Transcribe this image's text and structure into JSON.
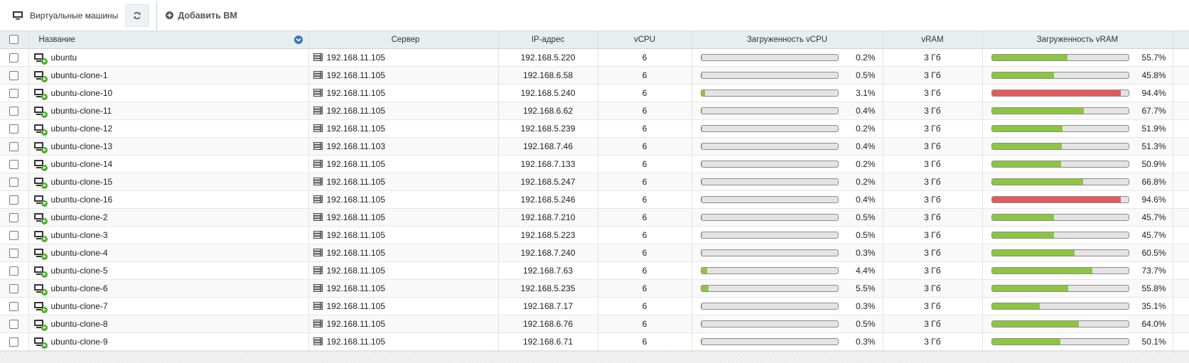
{
  "toolbar": {
    "title": "Виртуальные машины",
    "add_label": "Добавить ВМ"
  },
  "columns": {
    "name": "Название",
    "server": "Сервер",
    "ip": "IP-адрес",
    "vcpu": "vCPU",
    "cpu_load": "Загруженность vCPU",
    "vram": "vRAM",
    "ram_load": "Загруженность vRAM"
  },
  "colors": {
    "ok": "#8cc63f",
    "high": "#e05c5c",
    "running": "#4caf27"
  },
  "vms": [
    {
      "name": "ubuntu",
      "server": "192.168.11.105",
      "ip": "192.168.5.220",
      "vcpu": "6",
      "cpu": 0.2,
      "cpu_label": "0.2%",
      "vram": "3 Гб",
      "ram": 55.7,
      "ram_label": "55.7%"
    },
    {
      "name": "ubuntu-clone-1",
      "server": "192.168.11.105",
      "ip": "192.168.6.58",
      "vcpu": "6",
      "cpu": 0.5,
      "cpu_label": "0.5%",
      "vram": "3 Гб",
      "ram": 45.8,
      "ram_label": "45.8%"
    },
    {
      "name": "ubuntu-clone-10",
      "server": "192.168.11.105",
      "ip": "192.168.5.240",
      "vcpu": "6",
      "cpu": 3.1,
      "cpu_label": "3.1%",
      "vram": "3 Гб",
      "ram": 94.4,
      "ram_label": "94.4%"
    },
    {
      "name": "ubuntu-clone-11",
      "server": "192.168.11.105",
      "ip": "192.168.6.62",
      "vcpu": "6",
      "cpu": 0.4,
      "cpu_label": "0.4%",
      "vram": "3 Гб",
      "ram": 67.7,
      "ram_label": "67.7%"
    },
    {
      "name": "ubuntu-clone-12",
      "server": "192.168.11.105",
      "ip": "192.168.5.239",
      "vcpu": "6",
      "cpu": 0.2,
      "cpu_label": "0.2%",
      "vram": "3 Гб",
      "ram": 51.9,
      "ram_label": "51.9%"
    },
    {
      "name": "ubuntu-clone-13",
      "server": "192.168.11.103",
      "ip": "192.168.7.46",
      "vcpu": "6",
      "cpu": 0.4,
      "cpu_label": "0.4%",
      "vram": "3 Гб",
      "ram": 51.3,
      "ram_label": "51.3%"
    },
    {
      "name": "ubuntu-clone-14",
      "server": "192.168.11.105",
      "ip": "192.168.7.133",
      "vcpu": "6",
      "cpu": 0.2,
      "cpu_label": "0.2%",
      "vram": "3 Гб",
      "ram": 50.9,
      "ram_label": "50.9%"
    },
    {
      "name": "ubuntu-clone-15",
      "server": "192.168.11.105",
      "ip": "192.168.5.247",
      "vcpu": "6",
      "cpu": 0.2,
      "cpu_label": "0.2%",
      "vram": "3 Гб",
      "ram": 66.8,
      "ram_label": "66.8%"
    },
    {
      "name": "ubuntu-clone-16",
      "server": "192.168.11.105",
      "ip": "192.168.5.246",
      "vcpu": "6",
      "cpu": 0.4,
      "cpu_label": "0.4%",
      "vram": "3 Гб",
      "ram": 94.6,
      "ram_label": "94.6%"
    },
    {
      "name": "ubuntu-clone-2",
      "server": "192.168.11.105",
      "ip": "192.168.7.210",
      "vcpu": "6",
      "cpu": 0.5,
      "cpu_label": "0.5%",
      "vram": "3 Гб",
      "ram": 45.7,
      "ram_label": "45.7%"
    },
    {
      "name": "ubuntu-clone-3",
      "server": "192.168.11.105",
      "ip": "192.168.5.223",
      "vcpu": "6",
      "cpu": 0.5,
      "cpu_label": "0.5%",
      "vram": "3 Гб",
      "ram": 45.7,
      "ram_label": "45.7%"
    },
    {
      "name": "ubuntu-clone-4",
      "server": "192.168.11.105",
      "ip": "192.168.7.240",
      "vcpu": "6",
      "cpu": 0.3,
      "cpu_label": "0.3%",
      "vram": "3 Гб",
      "ram": 60.5,
      "ram_label": "60.5%"
    },
    {
      "name": "ubuntu-clone-5",
      "server": "192.168.11.105",
      "ip": "192.168.7.63",
      "vcpu": "6",
      "cpu": 4.4,
      "cpu_label": "4.4%",
      "vram": "3 Гб",
      "ram": 73.7,
      "ram_label": "73.7%"
    },
    {
      "name": "ubuntu-clone-6",
      "server": "192.168.11.105",
      "ip": "192.168.5.235",
      "vcpu": "6",
      "cpu": 5.5,
      "cpu_label": "5.5%",
      "vram": "3 Гб",
      "ram": 55.8,
      "ram_label": "55.8%"
    },
    {
      "name": "ubuntu-clone-7",
      "server": "192.168.11.105",
      "ip": "192.168.7.17",
      "vcpu": "6",
      "cpu": 0.3,
      "cpu_label": "0.3%",
      "vram": "3 Гб",
      "ram": 35.1,
      "ram_label": "35.1%"
    },
    {
      "name": "ubuntu-clone-8",
      "server": "192.168.11.105",
      "ip": "192.168.6.76",
      "vcpu": "6",
      "cpu": 0.5,
      "cpu_label": "0.5%",
      "vram": "3 Гб",
      "ram": 64.0,
      "ram_label": "64.0%"
    },
    {
      "name": "ubuntu-clone-9",
      "server": "192.168.11.105",
      "ip": "192.168.6.71",
      "vcpu": "6",
      "cpu": 0.3,
      "cpu_label": "0.3%",
      "vram": "3 Гб",
      "ram": 50.1,
      "ram_label": "50.1%"
    }
  ]
}
